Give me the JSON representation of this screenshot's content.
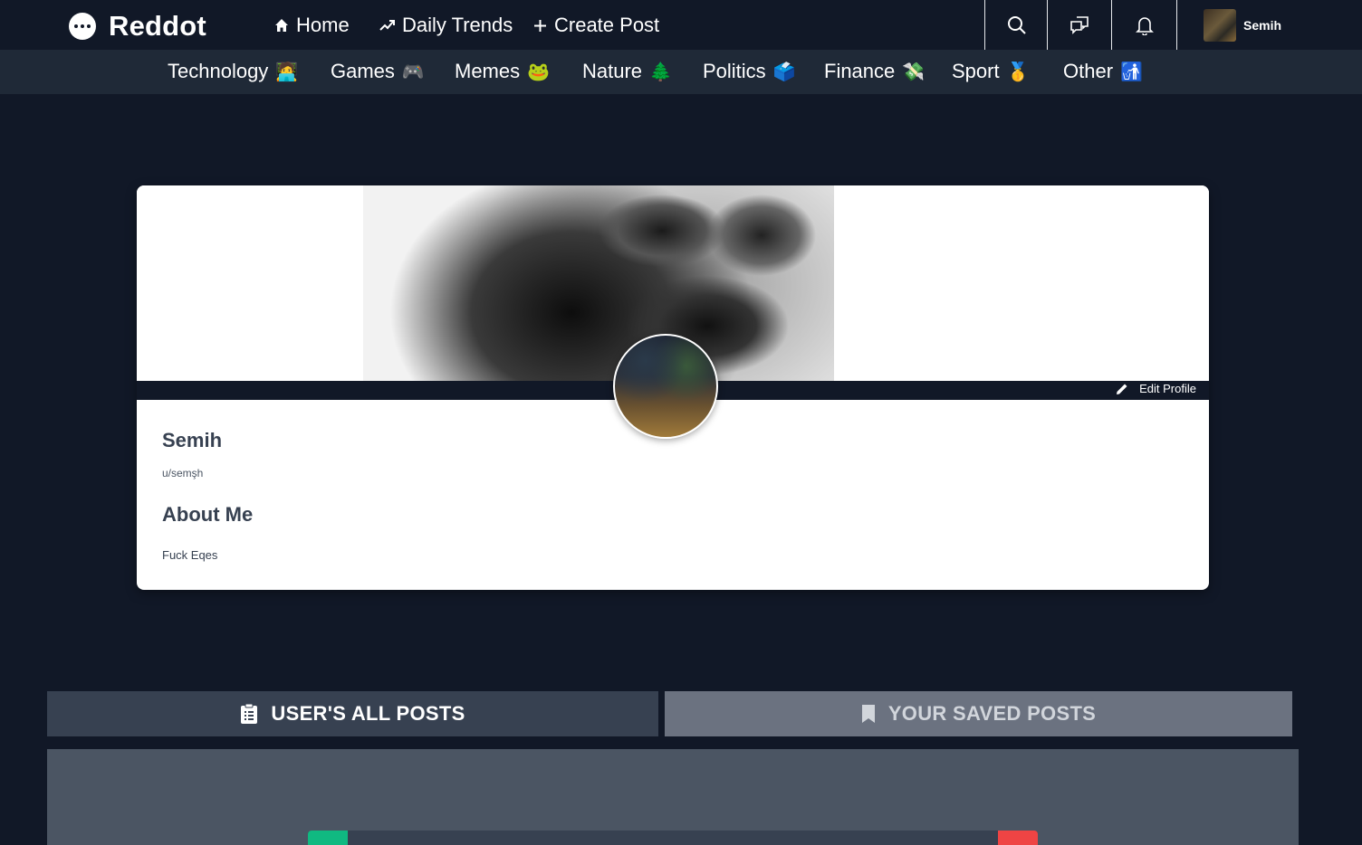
{
  "header": {
    "brand": "Reddot",
    "nav": [
      {
        "label": "Home",
        "icon": "home-icon"
      },
      {
        "label": "Daily Trends",
        "icon": "trending-icon"
      },
      {
        "label": "Create Post",
        "icon": "plus-icon"
      }
    ],
    "icons": [
      "search-icon",
      "chat-icon",
      "bell-icon"
    ],
    "user_name": "Semih"
  },
  "categories": [
    {
      "label": "Technology",
      "emoji": "🧑‍💻"
    },
    {
      "label": "Games",
      "emoji": "🎮"
    },
    {
      "label": "Memes",
      "emoji": "🐸"
    },
    {
      "label": "Nature",
      "emoji": "🌲"
    },
    {
      "label": "Politics",
      "emoji": "🗳️"
    },
    {
      "label": "Finance",
      "emoji": "💸"
    },
    {
      "label": "Sport",
      "emoji": "🥇"
    },
    {
      "label": "Other",
      "emoji": "🚮"
    }
  ],
  "profile": {
    "edit_label": "Edit Profile",
    "name": "Semih",
    "handle": "u/semşh",
    "about_title": "About Me",
    "about_text": "Fuck Eqes"
  },
  "tabs": {
    "all_posts": "USER'S ALL POSTS",
    "saved_posts": "YOUR SAVED POSTS"
  },
  "colors": {
    "background": "#111827",
    "category_bar": "#1f2937",
    "active_tab": "#374151",
    "inactive_tab": "#6b7280",
    "upvote": "#10b981",
    "downvote": "#ef4444"
  }
}
